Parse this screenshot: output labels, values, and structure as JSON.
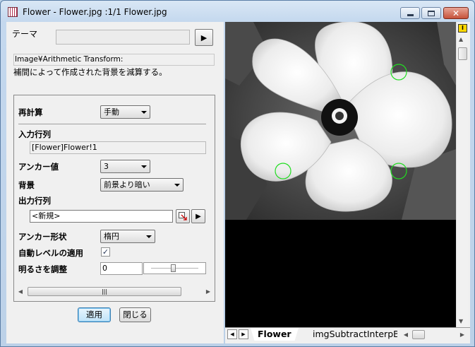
{
  "window": {
    "title": "Flower - Flower.jpg :1/1 Flower.jpg",
    "buttons": {
      "minimize": "minimize",
      "maximize": "maximize",
      "close": "✕"
    }
  },
  "dialog": {
    "theme_label": "テーマ",
    "theme_value": "",
    "theme_arrow": "▶",
    "function_path": "Image¥Arithmetic Transform:",
    "description": "補間によって作成された背景を減算する。",
    "recalc": {
      "label": "再計算",
      "value": "手動"
    },
    "input_matrix": {
      "label": "入力行列",
      "value": "[Flower]Flower!1"
    },
    "anchor_count": {
      "label": "アンカー値",
      "value": "3"
    },
    "background": {
      "label": "背景",
      "value": "前景より暗い"
    },
    "output_matrix": {
      "label": "出力行列",
      "value": "<新規>",
      "arrow": "▶"
    },
    "anchor_shape": {
      "label": "アンカー形状",
      "value": "楕円"
    },
    "auto_level": {
      "label": "自動レベルの適用",
      "checked": "✓"
    },
    "brightness": {
      "label": "明るさを調整",
      "value": "0",
      "slider_fraction": 0.48
    },
    "hscroll_grip": "|||",
    "apply_label": "適用",
    "close_label": "閉じる"
  },
  "image_view": {
    "sheet_tabs": [
      "Flower",
      "imgSubtractInterpBl"
    ],
    "toolbar_badge": "I",
    "anchor_color": "#22dd22",
    "nav_prev": "◀",
    "nav_next": "▶"
  }
}
